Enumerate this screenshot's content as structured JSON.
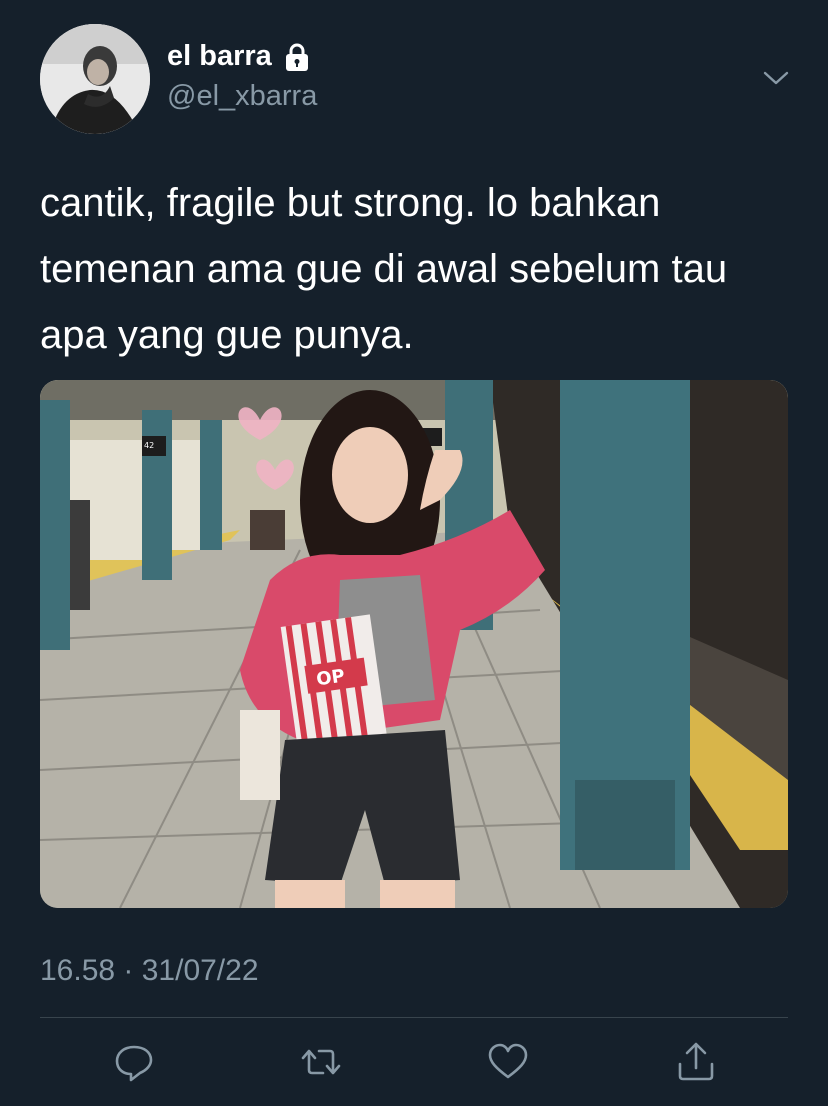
{
  "user": {
    "display_name": "el barra",
    "handle": "@el_xbarra",
    "protected_icon": "lock-icon"
  },
  "tweet": {
    "text": "cantik, fragile but strong. lo bahkan temenan ama gue di awal sebelum tau apa yang gue punya.",
    "timestamp": "16.58 · 31/07/22",
    "media_sign_label": "42",
    "media_box_text": "OP"
  },
  "actions": {
    "reply_icon": "reply-icon",
    "retweet_icon": "retweet-icon",
    "like_icon": "heart-icon",
    "share_icon": "share-icon"
  },
  "colors": {
    "background": "#15202b",
    "text_primary": "#ffffff",
    "text_secondary": "#8899a6",
    "divider": "#38444d"
  }
}
